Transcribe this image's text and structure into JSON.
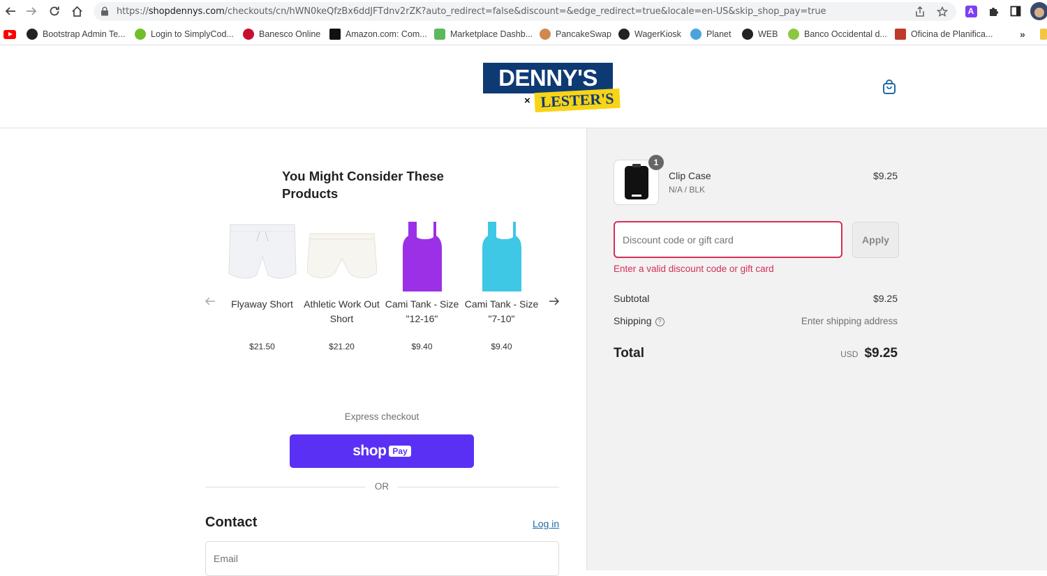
{
  "browser": {
    "url_prefix": "https://",
    "url_host": "shopdennys.com",
    "url_path": "/checkouts/cn/hWN0keQfzBx6ddJFTdnv2rZK?auto_redirect=false&discount=&edge_redirect=true&locale=en-US&skip_shop_pay=true",
    "more_label": "»",
    "bookmarks": [
      {
        "label": "Bootstrap Admin Te...",
        "icon": "globe-icon",
        "color": "#222222"
      },
      {
        "label": "Login to SimplyCod...",
        "icon": "check-icon",
        "color": "#6fbf2a"
      },
      {
        "label": "Banesco Online",
        "icon": "banesco-icon",
        "color": "#c8102e"
      },
      {
        "label": "Amazon.com: Com...",
        "icon": "amazon-icon",
        "color": "#111111"
      },
      {
        "label": "Marketplace Dashb...",
        "icon": "clover-icon",
        "color": "#5cb85c"
      },
      {
        "label": "PancakeSwap",
        "icon": "pancake-icon",
        "color": "#d1884f"
      },
      {
        "label": "WagerKiosk",
        "icon": "globe-icon",
        "color": "#222222"
      },
      {
        "label": "Planet",
        "icon": "planet-icon",
        "color": "#4aa3df"
      },
      {
        "label": "WEB",
        "icon": "globe-icon",
        "color": "#222222"
      },
      {
        "label": "Banco Occidental d...",
        "icon": "bod-icon",
        "color": "#8dc63f"
      },
      {
        "label": "Oficina de Planifica...",
        "icon": "ofi-icon",
        "color": "#c0392b"
      }
    ]
  },
  "store": {
    "logo_top": "DENNY'S",
    "logo_x": "×",
    "logo_bottom": "LESTER'S"
  },
  "recommendations": {
    "title": "You Might Consider These Products",
    "products": [
      {
        "name": "Flyaway Short",
        "price": "$21.50",
        "color": "#f3f3f6"
      },
      {
        "name": "Athletic Work Out Short",
        "price": "$21.20",
        "color": "#f6f4ee"
      },
      {
        "name": "Cami Tank - Size \"12-16\"",
        "price": "$9.40",
        "color": "#9b30e6"
      },
      {
        "name": "Cami Tank - Size \"7-10\"",
        "price": "$9.40",
        "color": "#3fc7e6"
      }
    ]
  },
  "express": {
    "label": "Express checkout",
    "shop_label": "shop",
    "pay_label": "Pay",
    "or_label": "OR"
  },
  "contact": {
    "title": "Contact",
    "login_label": "Log in",
    "email_placeholder": "Email"
  },
  "summary": {
    "item": {
      "name": "Clip Case",
      "variant": "N/A / BLK",
      "price": "$9.25",
      "quantity": "1"
    },
    "discount_placeholder": "Discount code or gift card",
    "apply_label": "Apply",
    "error": "Enter a valid discount code or gift card",
    "subtotal_label": "Subtotal",
    "subtotal_value": "$9.25",
    "shipping_label": "Shipping",
    "shipping_value": "Enter shipping address",
    "total_label": "Total",
    "currency": "USD",
    "total_value": "$9.25",
    "error_color": "#d42f57",
    "accent_color": "#5a31f4"
  }
}
